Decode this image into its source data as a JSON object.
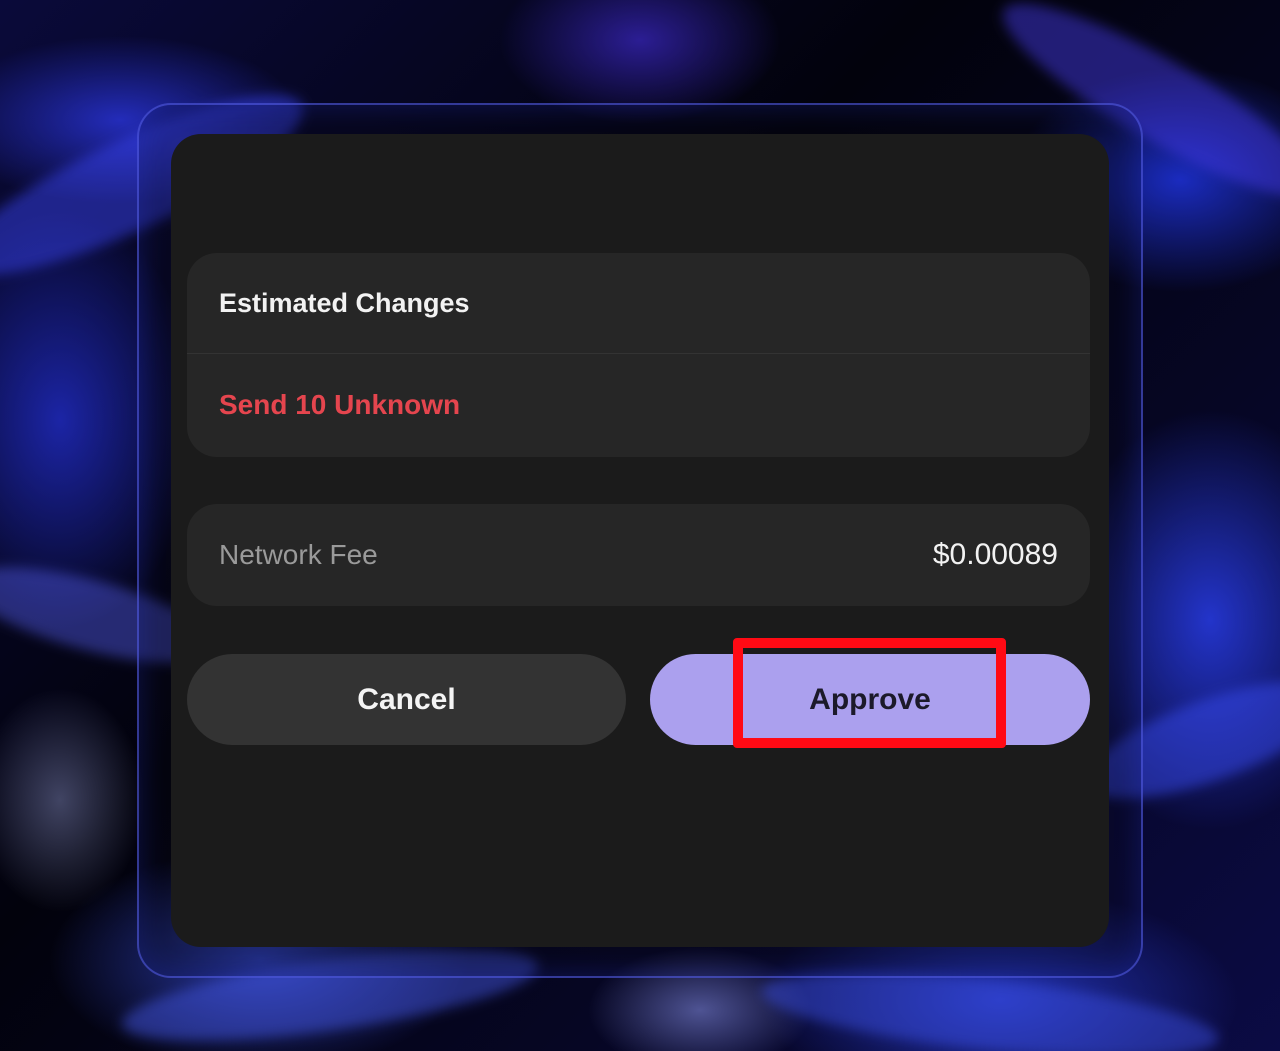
{
  "colors": {
    "dialog_bg": "#1b1b1b",
    "card_bg": "#262626",
    "send_text": "#e5454e",
    "approve_bg": "#aba0ee",
    "cancel_bg": "#333333",
    "highlight": "#ff0a14"
  },
  "estimated_changes": {
    "title": "Estimated Changes",
    "items": [
      {
        "text": "Send 10 Unknown"
      }
    ]
  },
  "network_fee": {
    "label": "Network Fee",
    "value": "$0.00089"
  },
  "actions": {
    "cancel_label": "Cancel",
    "approve_label": "Approve"
  }
}
